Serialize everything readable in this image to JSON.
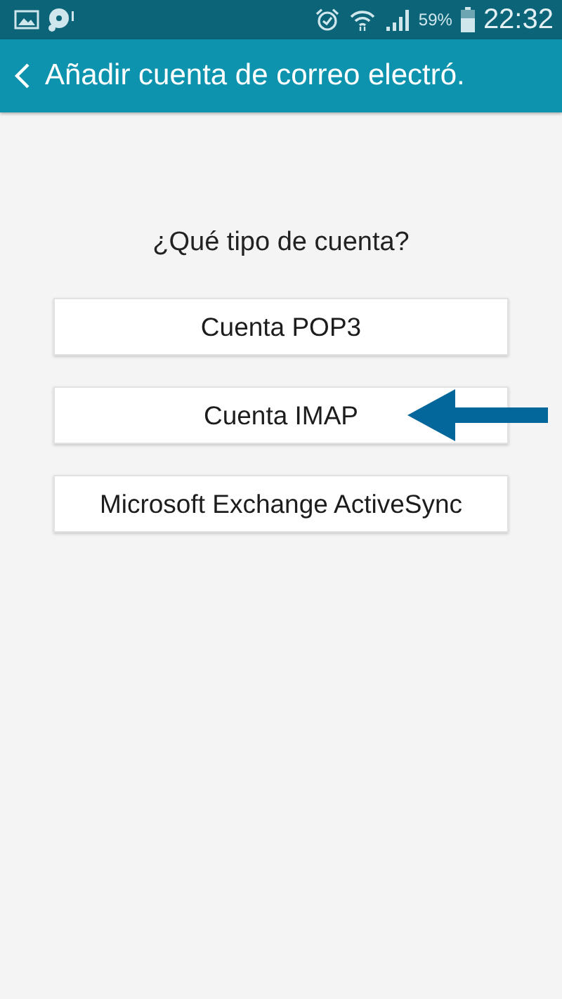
{
  "status_bar": {
    "battery_percent": "59%",
    "time": "22:32"
  },
  "app_bar": {
    "title": "Añadir cuenta de correo electró."
  },
  "question": "¿Qué tipo de cuenta?",
  "options": [
    {
      "label": "Cuenta POP3",
      "marked": false
    },
    {
      "label": "Cuenta IMAP",
      "marked": true
    },
    {
      "label": "Microsoft Exchange ActiveSync",
      "marked": false
    }
  ]
}
